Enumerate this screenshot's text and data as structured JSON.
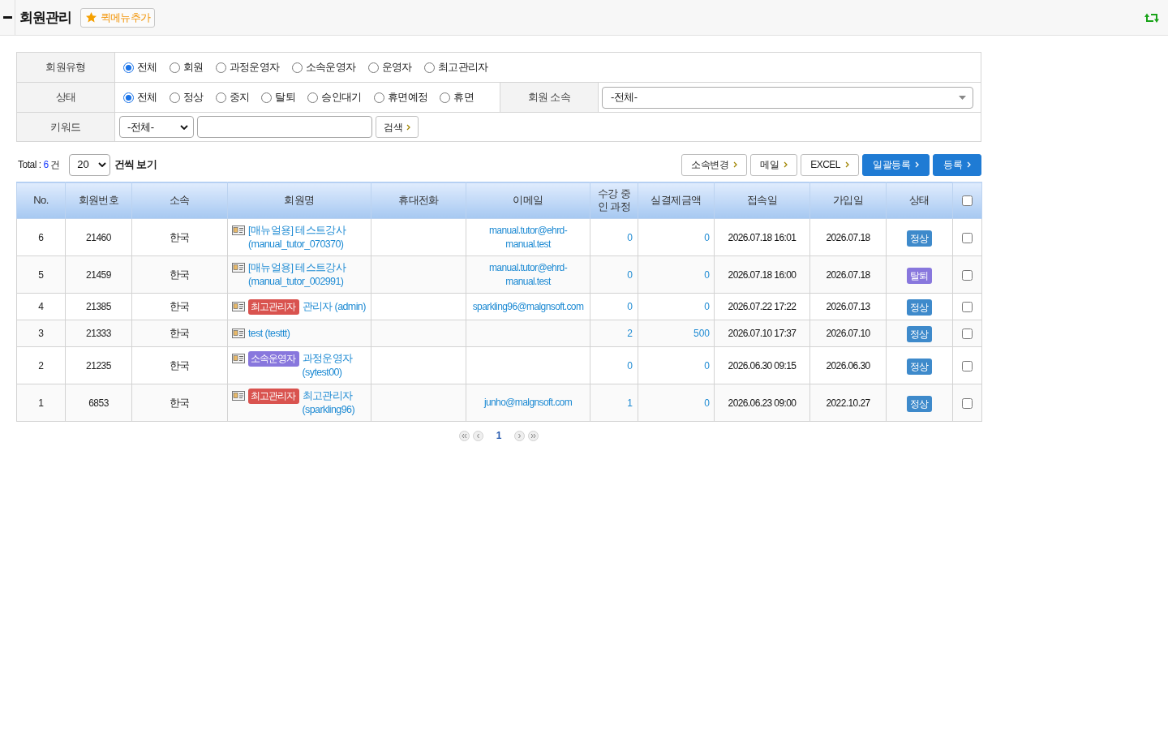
{
  "header": {
    "title": "회원관리",
    "quick_menu_button": "퀵메뉴추가"
  },
  "filters": {
    "member_type": {
      "label": "회원유형",
      "options": [
        {
          "label": "전체",
          "selected": true
        },
        {
          "label": "회원",
          "selected": false
        },
        {
          "label": "과정운영자",
          "selected": false
        },
        {
          "label": "소속운영자",
          "selected": false
        },
        {
          "label": "운영자",
          "selected": false
        },
        {
          "label": "최고관리자",
          "selected": false
        }
      ]
    },
    "status": {
      "label": "상태",
      "options": [
        {
          "label": "전체",
          "selected": true
        },
        {
          "label": "정상",
          "selected": false
        },
        {
          "label": "중지",
          "selected": false
        },
        {
          "label": "탈퇴",
          "selected": false
        },
        {
          "label": "승인대기",
          "selected": false
        },
        {
          "label": "휴면예정",
          "selected": false
        },
        {
          "label": "휴면",
          "selected": false
        }
      ]
    },
    "affiliation": {
      "label": "회원 소속",
      "value": "-전체-"
    },
    "keyword": {
      "label": "키워드",
      "field_select": "-전체-",
      "search_button": "검색"
    }
  },
  "summary": {
    "total_label": "Total :",
    "total_count": "6",
    "count_unit": "건",
    "page_size": "20",
    "page_size_suffix": "건씩 보기"
  },
  "actions": [
    {
      "label": "소속변경",
      "kind": "secondary"
    },
    {
      "label": "메일",
      "kind": "secondary"
    },
    {
      "label": "EXCEL",
      "kind": "secondary"
    },
    {
      "label": "일괄등록",
      "kind": "primary"
    },
    {
      "label": "등록",
      "kind": "primary"
    }
  ],
  "table": {
    "columns": [
      "No.",
      "회원번호",
      "소속",
      "회원명",
      "휴대전화",
      "이메일",
      "수강 중인 과정",
      "실결제금액",
      "접속일",
      "가입일",
      "상태"
    ],
    "select_all": {
      "checked": false
    },
    "rows": [
      {
        "no": "6",
        "member_no": "21460",
        "affiliation": "한국",
        "name": "[매뉴얼용] 테스트강사 (manual_tutor_070370)",
        "email": "manual.tutor@ehrd-manual.test",
        "courses": "0",
        "payment": "0",
        "last_login": "2026.07.18 16:01",
        "joined": "2026.07.18",
        "status": {
          "label": "정상",
          "color": "#3e8acb"
        },
        "checked": false
      },
      {
        "no": "5",
        "member_no": "21459",
        "affiliation": "한국",
        "name": "[매뉴얼용] 테스트강사 (manual_tutor_002991)",
        "email": "manual.tutor@ehrd-manual.test",
        "courses": "0",
        "payment": "0",
        "last_login": "2026.07.18 16:00",
        "joined": "2026.07.18",
        "status": {
          "label": "탈퇴",
          "color": "#8877dd"
        },
        "checked": false
      },
      {
        "no": "4",
        "member_no": "21385",
        "affiliation": "한국",
        "role": {
          "label": "최고관리자",
          "color": "#d9534f"
        },
        "name": "관리자 (admin)",
        "email": "sparkling96@malgnsoft.com",
        "courses": "0",
        "payment": "0",
        "last_login": "2026.07.22 17:22",
        "joined": "2026.07.13",
        "status": {
          "label": "정상",
          "color": "#3e8acb"
        },
        "checked": false
      },
      {
        "no": "3",
        "member_no": "21333",
        "affiliation": "한국",
        "name": "test (testtt)",
        "courses": "2",
        "payment": "500",
        "last_login": "2026.07.10 17:37",
        "joined": "2026.07.10",
        "status": {
          "label": "정상",
          "color": "#3e8acb"
        },
        "checked": false
      },
      {
        "no": "2",
        "member_no": "21235",
        "affiliation": "한국",
        "role": {
          "label": "소속운영자",
          "color": "#8877dd"
        },
        "name": "과정운영자 (sytest00)",
        "courses": "0",
        "payment": "0",
        "last_login": "2026.06.30 09:15",
        "joined": "2026.06.30",
        "status": {
          "label": "정상",
          "color": "#3e8acb"
        },
        "checked": false
      },
      {
        "no": "1",
        "member_no": "6853",
        "affiliation": "한국",
        "role": {
          "label": "최고관리자",
          "color": "#d9534f"
        },
        "name": "최고관리자 (sparkling96)",
        "email": "junho@malgnsoft.com",
        "courses": "1",
        "payment": "0",
        "last_login": "2026.06.23 09:00",
        "joined": "2022.10.27",
        "status": {
          "label": "정상",
          "color": "#3e8acb"
        },
        "checked": false
      }
    ]
  },
  "pagination": {
    "pages": [
      {
        "label": "1",
        "selected": true
      }
    ]
  }
}
